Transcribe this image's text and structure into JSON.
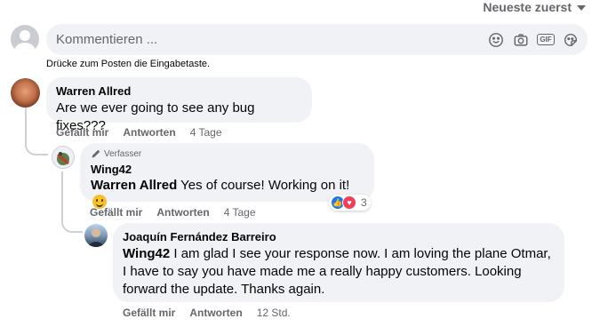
{
  "sort": {
    "label": "Neueste zuerst"
  },
  "composer": {
    "placeholder": "Kommentieren ...",
    "hint": "Drücke zum Posten die Eingabetaste."
  },
  "comments": [
    {
      "author": "Warren Allred",
      "text": "Are we ever going to see any bug fixes???",
      "like_label": "Gefällt mir",
      "reply_label": "Antworten",
      "time": "4 Tage"
    },
    {
      "badge": "Verfasser",
      "author": "Wing42",
      "mention": "Warren Allred",
      "text": "Yes of course! Working on it!",
      "reaction_count": "3",
      "like_label": "Gefällt mir",
      "reply_label": "Antworten",
      "time": "4 Tage"
    },
    {
      "author": "Joaquín Fernández Barreiro",
      "mention": "Wing42",
      "text_lines": [
        "I am glad I see your response now. I am loving the plane Otmar,",
        "I have to say you have made me a really happy customers. Looking",
        "forward the update. Thanks again."
      ],
      "like_label": "Gefällt mir",
      "reply_label": "Antworten",
      "time": "12 Std."
    }
  ],
  "colors": {
    "bubble": "#f0f2f5",
    "secondary_text": "#65676b",
    "like_blue": "#1877f2",
    "love_red": "#f33e58"
  },
  "icons": [
    "smile-icon",
    "camera-icon",
    "gif-icon",
    "sticker-icon",
    "pencil-icon",
    "caret-down-icon"
  ]
}
